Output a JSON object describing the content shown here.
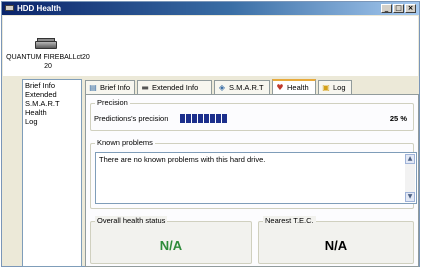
{
  "window": {
    "title": "HDD Health"
  },
  "drive": {
    "label": "QUANTUM FIREBALLct20 20",
    "icon": "hard-drive-icon"
  },
  "nav": {
    "items": [
      {
        "label": "Brief Info"
      },
      {
        "label": "Extended"
      },
      {
        "label": "S.M.A.R.T"
      },
      {
        "label": "Health"
      },
      {
        "label": "Log"
      }
    ]
  },
  "tabs": [
    {
      "label": "Brief Info",
      "icon": "info-icon"
    },
    {
      "label": "Extended Info",
      "icon": "extended-icon"
    },
    {
      "label": "S.M.A.R.T",
      "icon": "smart-icon"
    },
    {
      "label": "Health",
      "icon": "health-icon",
      "active": true
    },
    {
      "label": "Log",
      "icon": "log-icon"
    }
  ],
  "precision": {
    "title": "Precision",
    "label": "Predictions's precision",
    "value_text": "25 %",
    "value": 25,
    "bar_color": "#1c2f8c"
  },
  "problems": {
    "title": "Known problems",
    "text": "There are no known problems with this hard drive."
  },
  "health_status": {
    "title": "Overall health status",
    "value": "N/A",
    "color": "#2e8b3a"
  },
  "tec": {
    "title": "Nearest T.E.C.",
    "value": "N/A",
    "color": "#000000"
  }
}
